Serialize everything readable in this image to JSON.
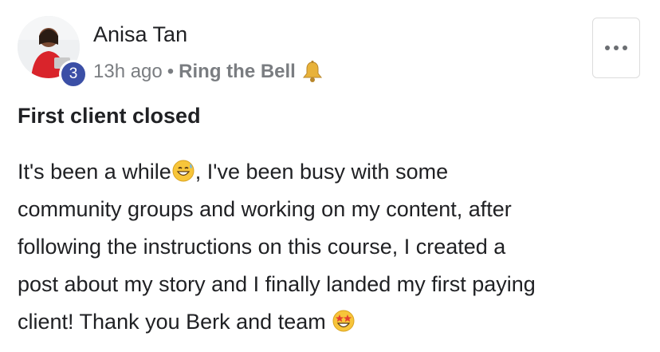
{
  "post": {
    "author": {
      "name": "Anisa Tan",
      "level": "3",
      "avatar": "avatar"
    },
    "meta": {
      "timestamp": "13h ago",
      "separator": "•",
      "category": "Ring the Bell",
      "category_icon": "bell-icon"
    },
    "more_button_icon": "more-dots-icon",
    "title": "First client closed",
    "body": {
      "line1_a": "It's been a while",
      "line1_emoji": "grinning-sweat-emoji",
      "line1_b": ", I've been busy with some",
      "line2": "community groups and working on my content, after",
      "line3": "following the instructions on this course, I created a",
      "line4": "post about my story and I finally landed my first paying",
      "line5": "client! Thank you Berk and team ",
      "line5_emoji": "star-struck-emoji"
    }
  },
  "colors": {
    "badge": "#3b4fa6",
    "meta_text": "#7a7d81",
    "bell": "#e8b23a"
  }
}
